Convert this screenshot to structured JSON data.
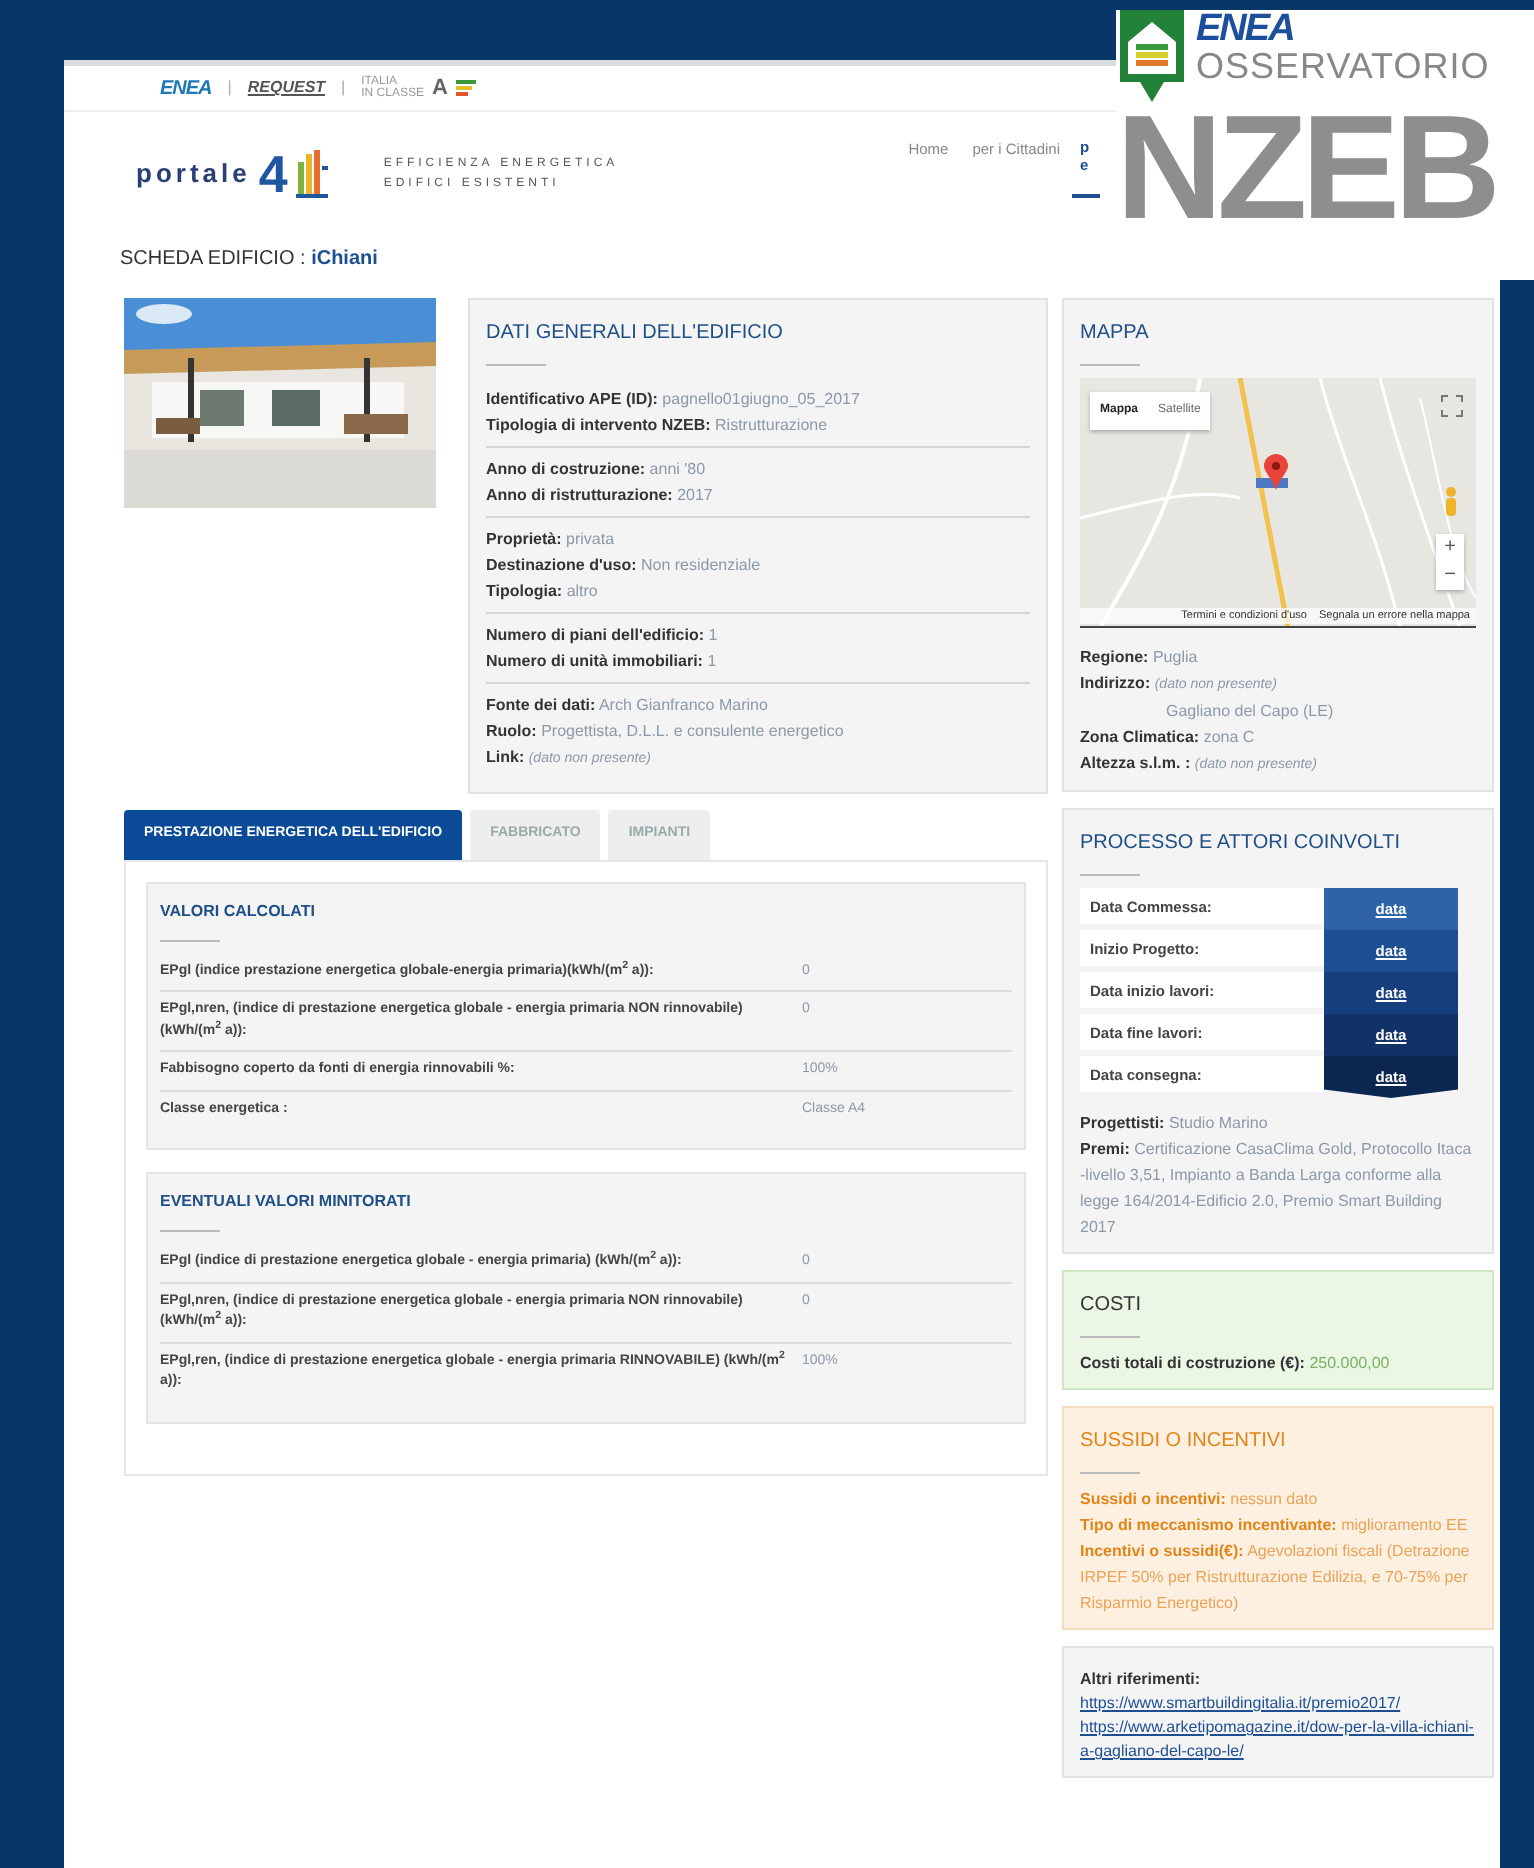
{
  "brand_bar": {
    "logos": [
      "ENEA",
      "REQUEST",
      "ITALIA",
      "IN CLASSE",
      "A"
    ],
    "separators": [
      "|",
      "|"
    ]
  },
  "portal": {
    "name": "portale",
    "mark": "4",
    "tagline": [
      "EFFICIENZA ENERGETICA",
      "EDIFICI ESISTENTI"
    ]
  },
  "nav": [
    {
      "label": "Home",
      "selected": false
    },
    {
      "label": "per i Cittadini",
      "selected": false
    },
    {
      "label": "p e",
      "selected": true
    }
  ],
  "overlay_logo": {
    "org": "ENEA",
    "title": "OSSERVATORIO",
    "big": "NZEB"
  },
  "page_title": {
    "label": "SCHEDA EDIFICIO :",
    "name": "iChiani"
  },
  "general": {
    "title": "DATI GENERALI DELL'EDIFICIO",
    "groups": [
      [
        {
          "label": "Identificativo APE (ID):",
          "value": "pagnello01giugno_05_2017",
          "missing": false
        },
        {
          "label": "Tipologia di intervento NZEB:",
          "value": "Ristrutturazione",
          "missing": false
        }
      ],
      [
        {
          "label": "Anno di costruzione:",
          "value": "anni '80",
          "missing": false
        },
        {
          "label": "Anno di ristrutturazione:",
          "value": "2017",
          "missing": false
        }
      ],
      [
        {
          "label": "Proprietà:",
          "value": "privata",
          "missing": false
        },
        {
          "label": "Destinazione d'uso:",
          "value": "Non residenziale",
          "missing": false
        },
        {
          "label": "Tipologia:",
          "value": "altro",
          "missing": false
        }
      ],
      [
        {
          "label": "Numero di piani dell'edificio:",
          "value": "1",
          "missing": false
        },
        {
          "label": "Numero di unità immobiliari:",
          "value": "1",
          "missing": false
        }
      ],
      [
        {
          "label": "Fonte dei dati:",
          "value": "Arch Gianfranco Marino",
          "missing": false
        },
        {
          "label": "Ruolo:",
          "value": "Progettista, D.L.L. e consulente energetico",
          "missing": false
        },
        {
          "label": "Link:",
          "value": "(dato non presente)",
          "missing": true
        }
      ]
    ]
  },
  "tabs": [
    {
      "label": "PRESTAZIONE ENERGETICA DELL'EDIFICIO",
      "selected": true
    },
    {
      "label": "FABBRICATO",
      "selected": false
    },
    {
      "label": "IMPIANTI",
      "selected": false
    }
  ],
  "value_sections": [
    {
      "title": "VALORI CALCOLATI",
      "rows": [
        {
          "label": "EPgl (indice prestazione energetica globale-energia primaria)(kWh/(m$^{2}$ a)):",
          "value": "0"
        },
        {
          "label": "EPgl,nren, (indice di prestazione energetica globale - energia primaria NON rinnovabile) (kWh/(m$^{2}$ a)):",
          "value": "0"
        },
        {
          "label": "Fabbisogno coperto da fonti di energia rinnovabili %:",
          "value": "100%"
        },
        {
          "label": "Classe energetica :",
          "value": "Classe A4"
        }
      ]
    },
    {
      "title": "EVENTUALI VALORI MINITORATI",
      "rows": [
        {
          "label": "EPgl (indice di prestazione energetica globale - energia primaria) (kWh/(m$^{2}$ a)):",
          "value": "0"
        },
        {
          "label": "EPgl,nren, (indice di prestazione energetica globale - energia primaria NON rinnovabile) (kWh/(m$^{2}$ a)):",
          "value": "0"
        },
        {
          "label": "EPgl,ren, (indice di prestazione energetica globale - energia primaria RINNOVABILE) (kWh/(m$^{2}$ a)):",
          "value": "100%"
        }
      ]
    }
  ],
  "map_card": {
    "title": "MAPPA",
    "map": {
      "kind": "picture",
      "type_buttons": [
        {
          "label": "Mappa",
          "selected": true
        },
        {
          "label": "Satellite",
          "selected": false
        }
      ],
      "zoom_in": "+",
      "zoom_out": "−",
      "footer_links": [
        "Termini e condizioni d'uso",
        "Segnala un errore nella mappa"
      ]
    },
    "fields": [
      {
        "label": "Regione:",
        "value": "Puglia",
        "missing": false
      },
      {
        "label": "Indirizzo:",
        "value": "(dato non presente)",
        "missing": true,
        "extra": "Gagliano del Capo (LE)"
      },
      {
        "label": "Zona Climatica:",
        "value": "zona C",
        "missing": false
      },
      {
        "label": "Altezza s.l.m. :",
        "value": "(dato non presente)",
        "missing": true
      }
    ]
  },
  "process_card": {
    "title": "PROCESSO E ATTORI COINVOLTI",
    "timeline": [
      {
        "label": "Data Commessa:",
        "value": "data",
        "color": "#2f63a8"
      },
      {
        "label": "Inizio Progetto:",
        "value": "data",
        "color": "#1f4f93"
      },
      {
        "label": "Data inizio lavori:",
        "value": "data",
        "color": "#173f7d"
      },
      {
        "label": "Data fine lavori:",
        "value": "data",
        "color": "#103266"
      },
      {
        "label": "Data consegna:",
        "value": "data",
        "color": "#0a2651"
      }
    ],
    "fields": [
      {
        "label": "Progettisti:",
        "value": "Studio Marino"
      },
      {
        "label": "Premi:",
        "value": "Certificazione CasaClima Gold, Protocollo Itaca -livello 3,51, Impianto a Banda Larga conforme alla legge 164/2014-Edificio 2.0, Premio Smart Building 2017"
      }
    ]
  },
  "costs_card": {
    "title": "COSTI",
    "fields": [
      {
        "label": "Costi totali di costruzione (€):",
        "value": "250.000,00"
      }
    ]
  },
  "incentives_card": {
    "title": "SUSSIDI O INCENTIVI",
    "fields": [
      {
        "label": "Sussidi o incentivi:",
        "value": "nessun dato"
      },
      {
        "label": "Tipo di meccanismo incentivante:",
        "value": "miglioramento EE"
      },
      {
        "label": "Incentivi o sussidi(€):",
        "value": "Agevolazioni fiscali (Detrazione IRPEF 50% per Ristrutturazione Edilizia, e 70-75% per Risparmio Energetico)"
      }
    ]
  },
  "references_card": {
    "title": "Altri riferimenti:",
    "links": [
      "https://www.smartbuildingitalia.it/premio2017/",
      "https://www.arketipomagazine.it/dow-per-la-villa-ichiani-a-gagliano-del-capo-le/"
    ]
  }
}
